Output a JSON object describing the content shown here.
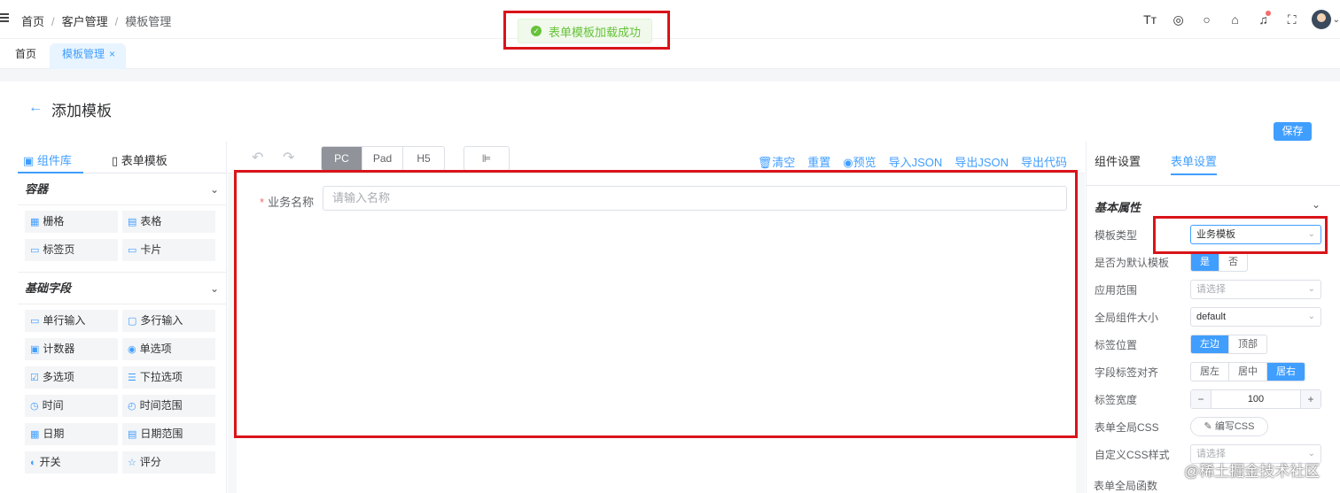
{
  "breadcrumb": [
    "首页",
    "客户管理",
    "模板管理"
  ],
  "toast": {
    "text": "表单模板加载成功",
    "color": "#67c23a"
  },
  "tabs": {
    "home": "首页",
    "active": "模板管理",
    "close": "×"
  },
  "page": {
    "title": "添加模板",
    "save": "保存"
  },
  "left_panel": {
    "tab_components": "组件库",
    "tab_templates": "表单模板",
    "groups": [
      {
        "title": "容器",
        "items": [
          "栅格",
          "表格",
          "标签页",
          "卡片"
        ]
      },
      {
        "title": "基础字段",
        "items": [
          "单行输入",
          "多行输入",
          "计数器",
          "单选项",
          "多选项",
          "下拉选项",
          "时间",
          "时间范围",
          "日期",
          "日期范围",
          "开关",
          "评分"
        ]
      }
    ]
  },
  "toolbar": {
    "devices": [
      "PC",
      "Pad",
      "H5"
    ],
    "actions": [
      "清空",
      "重置",
      "预览",
      "导入JSON",
      "导出JSON",
      "导出代码"
    ]
  },
  "form": {
    "field_label": "业务名称",
    "field_placeholder": "请输入名称"
  },
  "right_panel": {
    "tab_component": "组件设置",
    "tab_form": "表单设置",
    "section": "基本属性",
    "template_type_label": "模板类型",
    "template_type_value": "业务模板",
    "default_label": "是否为默认模板",
    "default_yes": "是",
    "default_no": "否",
    "scope_label": "应用范围",
    "scope_placeholder": "请选择",
    "size_label": "全局组件大小",
    "size_value": "default",
    "label_pos_label": "标签位置",
    "label_pos_left": "左边",
    "label_pos_top": "顶部",
    "align_label": "字段标签对齐",
    "align_left": "居左",
    "align_center": "居中",
    "align_right": "居右",
    "width_label": "标签宽度",
    "width_value": "100",
    "css_label": "表单全局CSS",
    "css_btn": "编写CSS",
    "custom_css_label": "自定义CSS样式",
    "custom_css_placeholder": "请选择",
    "func_label": "表单全局函数"
  },
  "watermark": "@稀土掘金技术社区"
}
